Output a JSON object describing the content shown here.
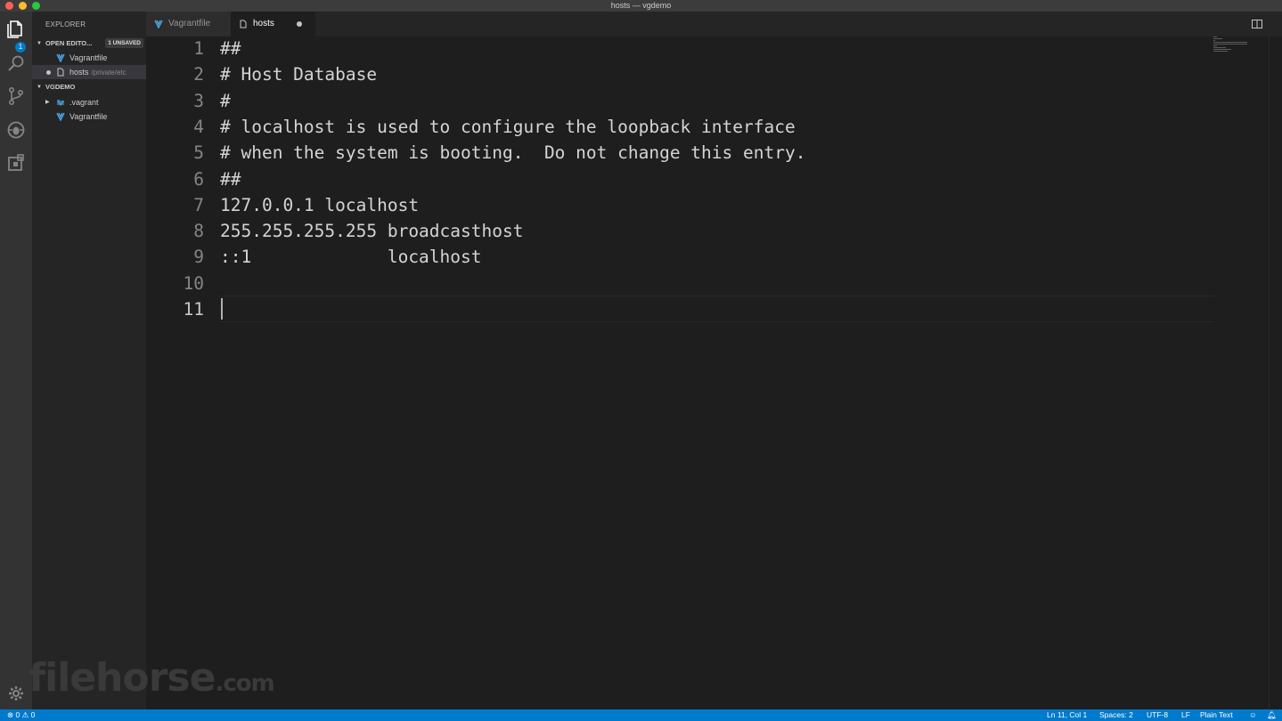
{
  "window": {
    "title": "hosts — vgdemo"
  },
  "activity_bar": {
    "items": [
      {
        "icon": "files-icon",
        "badge": "1"
      },
      {
        "icon": "search-icon"
      },
      {
        "icon": "source-control-icon"
      },
      {
        "icon": "debug-icon"
      },
      {
        "icon": "extensions-icon"
      }
    ],
    "bottom": {
      "icon": "gear-icon"
    }
  },
  "sidebar": {
    "title": "EXPLORER",
    "open_editors": {
      "label": "OPEN EDITO...",
      "badge": "1 UNSAVED",
      "items": [
        {
          "name": "Vagrantfile",
          "path": ""
        },
        {
          "name": "hosts",
          "path": "/private/etc",
          "unsaved": true
        }
      ]
    },
    "workspace": {
      "label": "VGDEMO",
      "items": [
        {
          "name": ".vagrant",
          "type": "folder"
        },
        {
          "name": "Vagrantfile",
          "type": "file"
        }
      ]
    }
  },
  "tabs": [
    {
      "label": "Vagrantfile",
      "active": false
    },
    {
      "label": "hosts",
      "active": true,
      "dirty": true
    }
  ],
  "editor": {
    "lines": [
      {
        "n": "1",
        "text": "##"
      },
      {
        "n": "2",
        "text": "# Host Database"
      },
      {
        "n": "3",
        "text": "#"
      },
      {
        "n": "4",
        "text": "# localhost is used to configure the loopback interface"
      },
      {
        "n": "5",
        "text": "# when the system is booting.  Do not change this entry."
      },
      {
        "n": "6",
        "text": "##"
      },
      {
        "n": "7",
        "text": "127.0.0.1 localhost"
      },
      {
        "n": "8",
        "text": "255.255.255.255 broadcasthost"
      },
      {
        "n": "9",
        "text": "::1             localhost"
      },
      {
        "n": "10",
        "text": ""
      },
      {
        "n": "11",
        "text": ""
      }
    ]
  },
  "watermark": {
    "text": "filehorse",
    "suffix": ".com"
  },
  "status_bar": {
    "errors": "0",
    "warnings": "0",
    "position": "Ln 11, Col 1",
    "spaces": "Spaces: 2",
    "encoding": "UTF-8",
    "eol": "LF",
    "language": "Plain Text"
  },
  "colors": {
    "accent": "#007acc",
    "vagrant_icon": "#4ea5e6",
    "editor_bg": "#1e1e1e"
  }
}
